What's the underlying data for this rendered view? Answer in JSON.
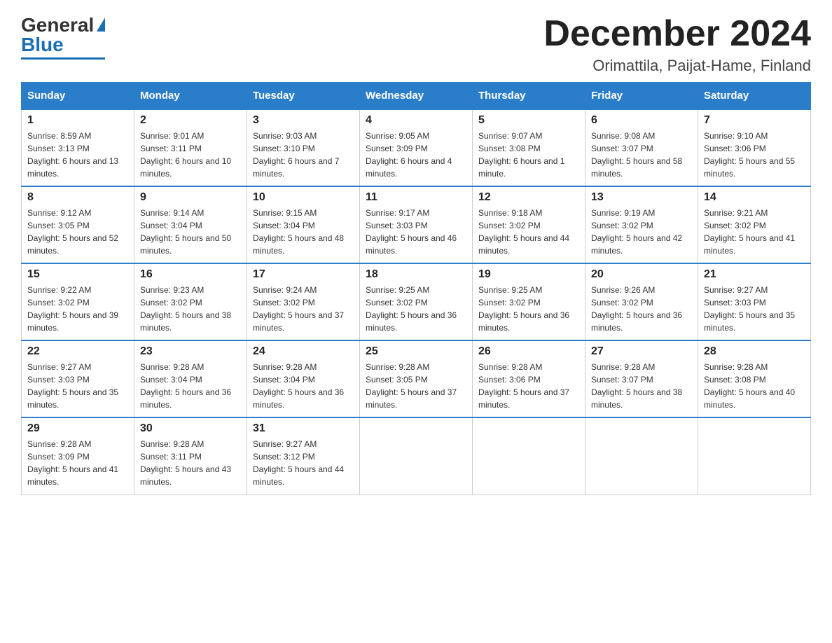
{
  "header": {
    "logo_general": "General",
    "logo_blue": "Blue",
    "month_title": "December 2024",
    "location": "Orimattila, Paijat-Hame, Finland"
  },
  "weekdays": [
    "Sunday",
    "Monday",
    "Tuesday",
    "Wednesday",
    "Thursday",
    "Friday",
    "Saturday"
  ],
  "weeks": [
    [
      {
        "day": "1",
        "sunrise": "8:59 AM",
        "sunset": "3:13 PM",
        "daylight": "6 hours and 13 minutes."
      },
      {
        "day": "2",
        "sunrise": "9:01 AM",
        "sunset": "3:11 PM",
        "daylight": "6 hours and 10 minutes."
      },
      {
        "day": "3",
        "sunrise": "9:03 AM",
        "sunset": "3:10 PM",
        "daylight": "6 hours and 7 minutes."
      },
      {
        "day": "4",
        "sunrise": "9:05 AM",
        "sunset": "3:09 PM",
        "daylight": "6 hours and 4 minutes."
      },
      {
        "day": "5",
        "sunrise": "9:07 AM",
        "sunset": "3:08 PM",
        "daylight": "6 hours and 1 minute."
      },
      {
        "day": "6",
        "sunrise": "9:08 AM",
        "sunset": "3:07 PM",
        "daylight": "5 hours and 58 minutes."
      },
      {
        "day": "7",
        "sunrise": "9:10 AM",
        "sunset": "3:06 PM",
        "daylight": "5 hours and 55 minutes."
      }
    ],
    [
      {
        "day": "8",
        "sunrise": "9:12 AM",
        "sunset": "3:05 PM",
        "daylight": "5 hours and 52 minutes."
      },
      {
        "day": "9",
        "sunrise": "9:14 AM",
        "sunset": "3:04 PM",
        "daylight": "5 hours and 50 minutes."
      },
      {
        "day": "10",
        "sunrise": "9:15 AM",
        "sunset": "3:04 PM",
        "daylight": "5 hours and 48 minutes."
      },
      {
        "day": "11",
        "sunrise": "9:17 AM",
        "sunset": "3:03 PM",
        "daylight": "5 hours and 46 minutes."
      },
      {
        "day": "12",
        "sunrise": "9:18 AM",
        "sunset": "3:02 PM",
        "daylight": "5 hours and 44 minutes."
      },
      {
        "day": "13",
        "sunrise": "9:19 AM",
        "sunset": "3:02 PM",
        "daylight": "5 hours and 42 minutes."
      },
      {
        "day": "14",
        "sunrise": "9:21 AM",
        "sunset": "3:02 PM",
        "daylight": "5 hours and 41 minutes."
      }
    ],
    [
      {
        "day": "15",
        "sunrise": "9:22 AM",
        "sunset": "3:02 PM",
        "daylight": "5 hours and 39 minutes."
      },
      {
        "day": "16",
        "sunrise": "9:23 AM",
        "sunset": "3:02 PM",
        "daylight": "5 hours and 38 minutes."
      },
      {
        "day": "17",
        "sunrise": "9:24 AM",
        "sunset": "3:02 PM",
        "daylight": "5 hours and 37 minutes."
      },
      {
        "day": "18",
        "sunrise": "9:25 AM",
        "sunset": "3:02 PM",
        "daylight": "5 hours and 36 minutes."
      },
      {
        "day": "19",
        "sunrise": "9:25 AM",
        "sunset": "3:02 PM",
        "daylight": "5 hours and 36 minutes."
      },
      {
        "day": "20",
        "sunrise": "9:26 AM",
        "sunset": "3:02 PM",
        "daylight": "5 hours and 36 minutes."
      },
      {
        "day": "21",
        "sunrise": "9:27 AM",
        "sunset": "3:03 PM",
        "daylight": "5 hours and 35 minutes."
      }
    ],
    [
      {
        "day": "22",
        "sunrise": "9:27 AM",
        "sunset": "3:03 PM",
        "daylight": "5 hours and 35 minutes."
      },
      {
        "day": "23",
        "sunrise": "9:28 AM",
        "sunset": "3:04 PM",
        "daylight": "5 hours and 36 minutes."
      },
      {
        "day": "24",
        "sunrise": "9:28 AM",
        "sunset": "3:04 PM",
        "daylight": "5 hours and 36 minutes."
      },
      {
        "day": "25",
        "sunrise": "9:28 AM",
        "sunset": "3:05 PM",
        "daylight": "5 hours and 37 minutes."
      },
      {
        "day": "26",
        "sunrise": "9:28 AM",
        "sunset": "3:06 PM",
        "daylight": "5 hours and 37 minutes."
      },
      {
        "day": "27",
        "sunrise": "9:28 AM",
        "sunset": "3:07 PM",
        "daylight": "5 hours and 38 minutes."
      },
      {
        "day": "28",
        "sunrise": "9:28 AM",
        "sunset": "3:08 PM",
        "daylight": "5 hours and 40 minutes."
      }
    ],
    [
      {
        "day": "29",
        "sunrise": "9:28 AM",
        "sunset": "3:09 PM",
        "daylight": "5 hours and 41 minutes."
      },
      {
        "day": "30",
        "sunrise": "9:28 AM",
        "sunset": "3:11 PM",
        "daylight": "5 hours and 43 minutes."
      },
      {
        "day": "31",
        "sunrise": "9:27 AM",
        "sunset": "3:12 PM",
        "daylight": "5 hours and 44 minutes."
      },
      null,
      null,
      null,
      null
    ]
  ],
  "labels": {
    "sunrise": "Sunrise:",
    "sunset": "Sunset:",
    "daylight": "Daylight:"
  }
}
